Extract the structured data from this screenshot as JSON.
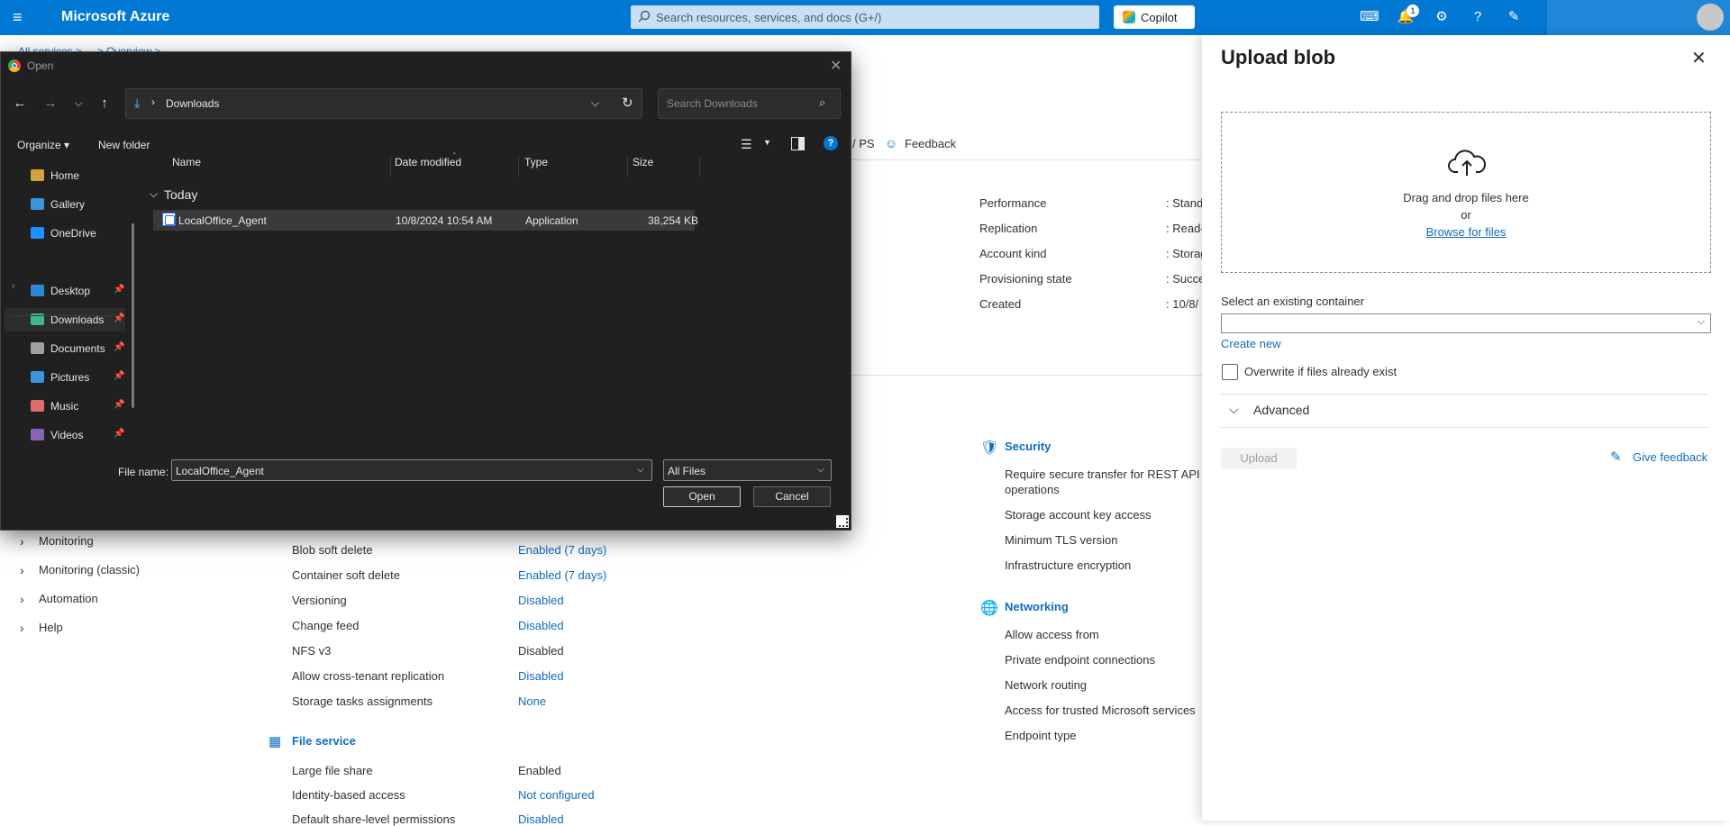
{
  "topbar": {
    "brand": "Microsoft Azure",
    "search_placeholder": "Search resources, services, and docs (G+/)",
    "copilot_label": "Copilot",
    "notification_count": "1"
  },
  "background": {
    "breadcrumb": "All services > ... > Overview >",
    "toolbar_items": [
      "/ PS",
      "Feedback"
    ],
    "properties": [
      {
        "label": "Performance",
        "value": ": Stand"
      },
      {
        "label": "Replication",
        "value": ": Read-"
      },
      {
        "label": "Account kind",
        "value": ": Storag"
      },
      {
        "label": "Provisioning state",
        "value": ": Succe"
      },
      {
        "label": "Created",
        "value": ": 10/8/"
      }
    ],
    "left_nav": [
      "Monitoring",
      "Monitoring (classic)",
      "Automation",
      "Help"
    ],
    "blob_rows": [
      {
        "label": "Blob soft delete",
        "value": "Enabled (7 days)",
        "link": true
      },
      {
        "label": "Container soft delete",
        "value": "Enabled (7 days)",
        "link": true
      },
      {
        "label": "Versioning",
        "value": "Disabled",
        "link": true
      },
      {
        "label": "Change feed",
        "value": "Disabled",
        "link": true
      },
      {
        "label": "NFS v3",
        "value": "Disabled",
        "link": false
      },
      {
        "label": "Allow cross-tenant replication",
        "value": "Disabled",
        "link": true
      },
      {
        "label": "Storage tasks assignments",
        "value": "None",
        "link": true
      }
    ],
    "file_service_title": "File service",
    "file_rows": [
      {
        "label": "Large file share",
        "value": "Enabled",
        "link": false
      },
      {
        "label": "Identity-based access",
        "value": "Not configured",
        "link": true
      },
      {
        "label": "Default share-level permissions",
        "value": "Disabled",
        "link": true
      }
    ],
    "security_title": "Security",
    "security_items": [
      "Require secure transfer for REST API",
      "operations",
      "Storage account key access",
      "Minimum TLS version",
      "Infrastructure encryption"
    ],
    "networking_title": "Networking",
    "networking_items": [
      "Allow access from",
      "Private endpoint connections",
      "Network routing",
      "Access for trusted Microsoft services",
      "Endpoint type"
    ]
  },
  "panel": {
    "title": "Upload blob",
    "drop_line1": "Drag and drop files here",
    "drop_line2": "or",
    "browse": "Browse for files",
    "container_label": "Select an existing container",
    "create_new": "Create new",
    "overwrite": "Overwrite if files already exist",
    "advanced": "Advanced",
    "upload": "Upload",
    "feedback": "Give feedback"
  },
  "dialog": {
    "title": "Open",
    "path": "Downloads",
    "search_placeholder": "Search Downloads",
    "organize": "Organize ▾",
    "new_folder": "New folder",
    "sidebar": [
      {
        "label": "Home",
        "color": "#d5a13f"
      },
      {
        "label": "Gallery",
        "color": "#3a96dd"
      },
      {
        "label": "OneDrive",
        "color": "#1e90ff"
      },
      {
        "label": "Desktop",
        "color": "#2b88d8"
      },
      {
        "label": "Downloads",
        "color": "#3fb68b"
      },
      {
        "label": "Documents",
        "color": "#a0a0a0"
      },
      {
        "label": "Pictures",
        "color": "#3a96dd"
      },
      {
        "label": "Music",
        "color": "#e06c6c"
      },
      {
        "label": "Videos",
        "color": "#8764b8"
      }
    ],
    "columns": [
      "Name",
      "Date modified",
      "Type",
      "Size"
    ],
    "group": "Today",
    "files": [
      {
        "name": "LocalOffice_Agent",
        "date": "10/8/2024 10:54 AM",
        "type": "Application",
        "size": "38,254 KB"
      }
    ],
    "filename_label": "File name:",
    "filename_value": "LocalOffice_Agent",
    "filetype": "All Files",
    "open": "Open",
    "cancel": "Cancel"
  }
}
